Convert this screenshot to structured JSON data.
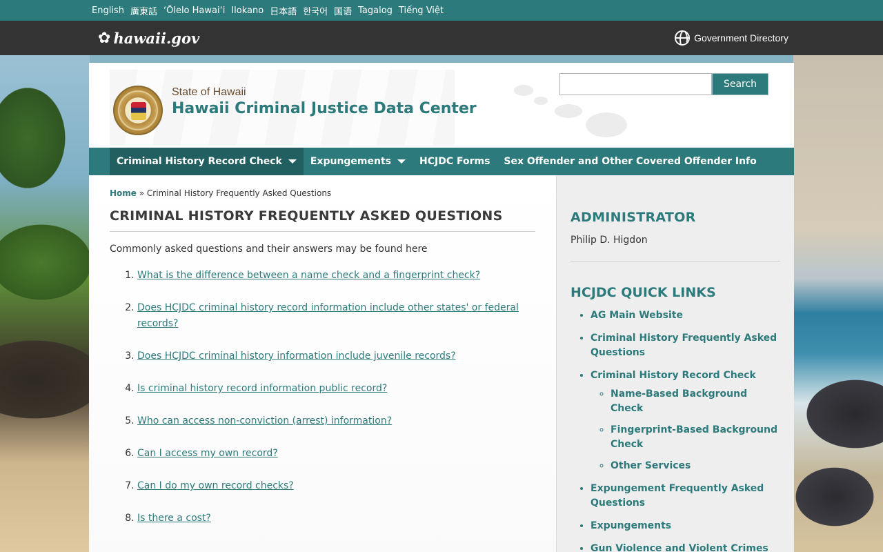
{
  "languages": [
    "English",
    "廣東話",
    "ʻŌlelo Hawaiʻi",
    "Ilokano",
    "日本語",
    "한국어",
    "国语",
    "Tagalog",
    "Tiếng Việt"
  ],
  "gov_bar": {
    "logo_text": "hawaii.gov",
    "directory_label": "Government Directory"
  },
  "header": {
    "state": "State of Hawaii",
    "site_name": "Hawaii Criminal Justice Data Center",
    "search_placeholder": "",
    "search_button": "Search"
  },
  "nav": [
    {
      "label": "Criminal History Record Check",
      "dropdown": true,
      "active": true
    },
    {
      "label": "Expungements",
      "dropdown": true,
      "active": false
    },
    {
      "label": "HCJDC Forms",
      "dropdown": false,
      "active": false
    },
    {
      "label": "Sex Offender and Other Covered Offender Info",
      "dropdown": false,
      "active": false
    }
  ],
  "breadcrumb": {
    "home": "Home",
    "separator": " » ",
    "current": "Criminal History Frequently Asked Questions"
  },
  "main": {
    "title": "CRIMINAL HISTORY FREQUENTLY ASKED QUESTIONS",
    "intro": "Commonly asked questions and their answers may be found here",
    "faq": [
      "What is the difference between a name check and a fingerprint check?",
      "Does HCJDC criminal history record information include other states' or federal records?",
      "Does HCJDC criminal history information include juvenile records?",
      "Is criminal history record information public record?",
      "Who can access non-conviction (arrest) information?",
      "Can I access my own record?",
      "Can I do my own record checks?",
      "Is there a cost?"
    ]
  },
  "sidebar": {
    "admin_heading": "ADMINISTRATOR",
    "admin_name": "Philip D. Higdon",
    "links_heading": "HCJDC QUICK LINKS",
    "links": {
      "ag_main": "AG Main Website",
      "faq": "Criminal History Frequently Asked Questions",
      "record_check": "Criminal History Record Check",
      "name_based": "Name-Based Background Check",
      "fingerprint_based": "Fingerprint-Based Background Check",
      "other_services": "Other Services",
      "expungement_faq": "Expungement Frequently Asked Questions",
      "expungements": "Expungements",
      "gun_violence": "Gun Violence and Violent Crimes"
    }
  },
  "colors": {
    "teal": "#2c7a7b",
    "dark_bar": "#333333",
    "sidebar_bg": "#eeeeee"
  }
}
